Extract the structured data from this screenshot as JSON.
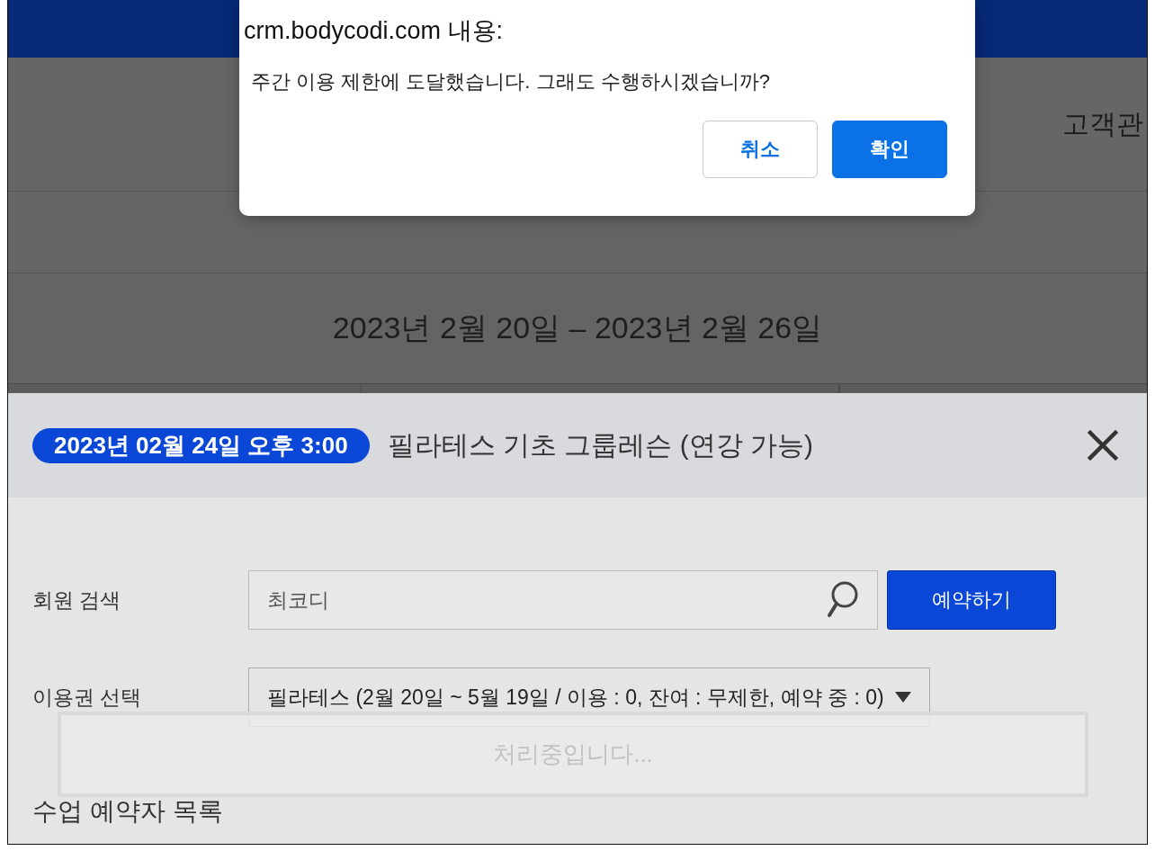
{
  "browser_alert": {
    "title": "crm.bodycodi.com 내용:",
    "message": "주간 이용 제한에 도달했습니다. 그래도 수행하시겠습니까?",
    "buttons": [
      {
        "label": "취소",
        "kind": "secondary"
      },
      {
        "label": "확인",
        "kind": "primary"
      }
    ]
  },
  "nav": {
    "items": [
      "고객관"
    ]
  },
  "week_range": "2023년 2월 20일 – 2023년 2월 26일",
  "booking_modal": {
    "time_badge": "2023년 02월 24일 오후 3:00",
    "class_title": "필라테스 기초 그룹레슨 (연강 가능)",
    "fields": [
      {
        "kind": "search",
        "label": "회원 검색",
        "value": "최코디"
      },
      {
        "kind": "select",
        "label": "이용권 선택",
        "value": "필라테스 (2월 20일 ~ 5월 19일 / 이용 : 0, 잔여 : 무제한, 예약 중 : 0)"
      }
    ],
    "reserve_button": "예약하기",
    "loading_message": "처리중입니다...",
    "section_title": "수업 예약자 목록"
  }
}
